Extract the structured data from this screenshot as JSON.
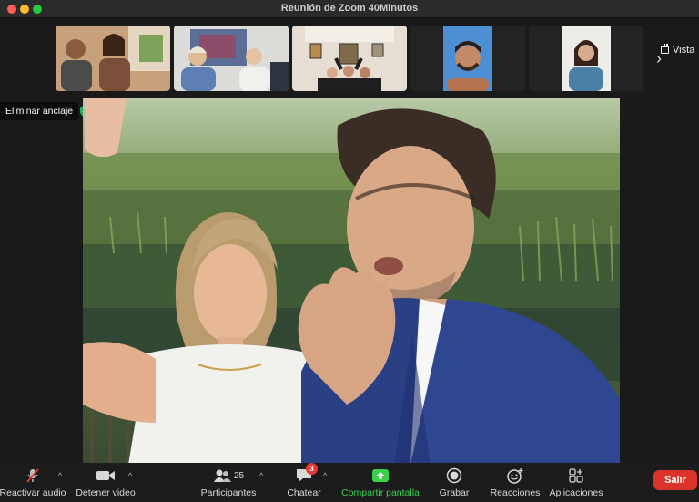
{
  "window": {
    "title": "Reunión de Zoom   40Minutos"
  },
  "strip": {
    "view_label": "Vista",
    "thumbnails": [
      {
        "name": "participants-group-1",
        "bg": "#a77f5d"
      },
      {
        "name": "participants-group-2",
        "bg": "#6f8aa0"
      },
      {
        "name": "participants-group-3",
        "bg": "#c9b49a"
      },
      {
        "name": "participant-4",
        "bg": "#5b8fc4"
      },
      {
        "name": "participant-5",
        "bg": "#d9d2c6"
      }
    ]
  },
  "spotlight": {
    "unpin_label": "Eliminar anclaje"
  },
  "toolbar": {
    "mute_label": "Reactivar audio",
    "video_label": "Detener video",
    "participants_label": "Participantes",
    "participants_count": "25",
    "chat_label": "Chatear",
    "chat_badge": "3",
    "share_label": "Compartir pantalla",
    "record_label": "Grabar",
    "reactions_label": "Reacciones",
    "apps_label": "Aplicaciones",
    "leave_label": "Salir"
  },
  "colors": {
    "leave": "#d9332b",
    "share": "#3ccf4e",
    "badge": "#e53935"
  }
}
